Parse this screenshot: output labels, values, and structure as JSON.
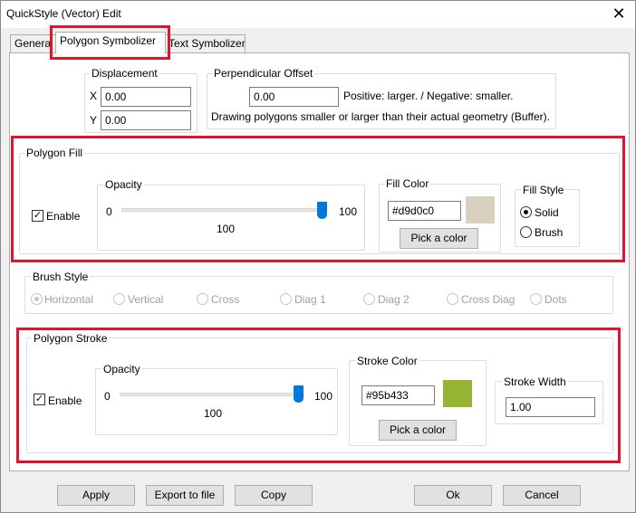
{
  "window": {
    "title": "QuickStyle (Vector) Edit",
    "close_glyph": "✕"
  },
  "tabs": [
    {
      "label": "General"
    },
    {
      "label": "Polygon Symbolizer"
    },
    {
      "label": "Text Symbolizer"
    }
  ],
  "displacement": {
    "label": "Displacement",
    "x_label": "X",
    "x_value": "0.00",
    "y_label": "Y",
    "y_value": "0.00"
  },
  "perpendicular_offset": {
    "label": "Perpendicular Offset",
    "value": "0.00",
    "hint": "Positive: larger. / Negative: smaller.",
    "description": "Drawing polygons smaller or larger than their actual geometry (Buffer)."
  },
  "polygon_fill": {
    "label": "Polygon Fill",
    "enable_label": "Enable",
    "enabled": true,
    "opacity": {
      "label": "Opacity",
      "min": "0",
      "max": "100",
      "value": "100",
      "level": 1.0
    },
    "fill_color": {
      "label": "Fill Color",
      "value": "#d9d0c0",
      "swatch": "#d9d0c0",
      "button": "Pick a color"
    },
    "fill_style": {
      "label": "Fill Style",
      "options": [
        "Solid",
        "Brush"
      ],
      "selected": "Solid"
    }
  },
  "brush_style": {
    "label": "Brush Style",
    "options": [
      "Horizontal",
      "Vertical",
      "Cross",
      "Diag 1",
      "Diag 2",
      "Cross Diag",
      "Dots"
    ],
    "selected": "Horizontal"
  },
  "polygon_stroke": {
    "label": "Polygon Stroke",
    "enable_label": "Enable",
    "enabled": true,
    "opacity": {
      "label": "Opacity",
      "min": "0",
      "max": "100",
      "value": "100",
      "level": 1.0
    },
    "stroke_color": {
      "label": "Stroke Color",
      "value": "#95b433",
      "swatch": "#95b433",
      "button": "Pick a color"
    },
    "stroke_width": {
      "label": "Stroke Width",
      "value": "1.00"
    }
  },
  "buttons": {
    "apply": "Apply",
    "export": "Export to file",
    "copy": "Copy",
    "ok": "Ok",
    "cancel": "Cancel"
  },
  "colors": {
    "highlight": "#e0142a",
    "slider_thumb": "#0078d7"
  }
}
